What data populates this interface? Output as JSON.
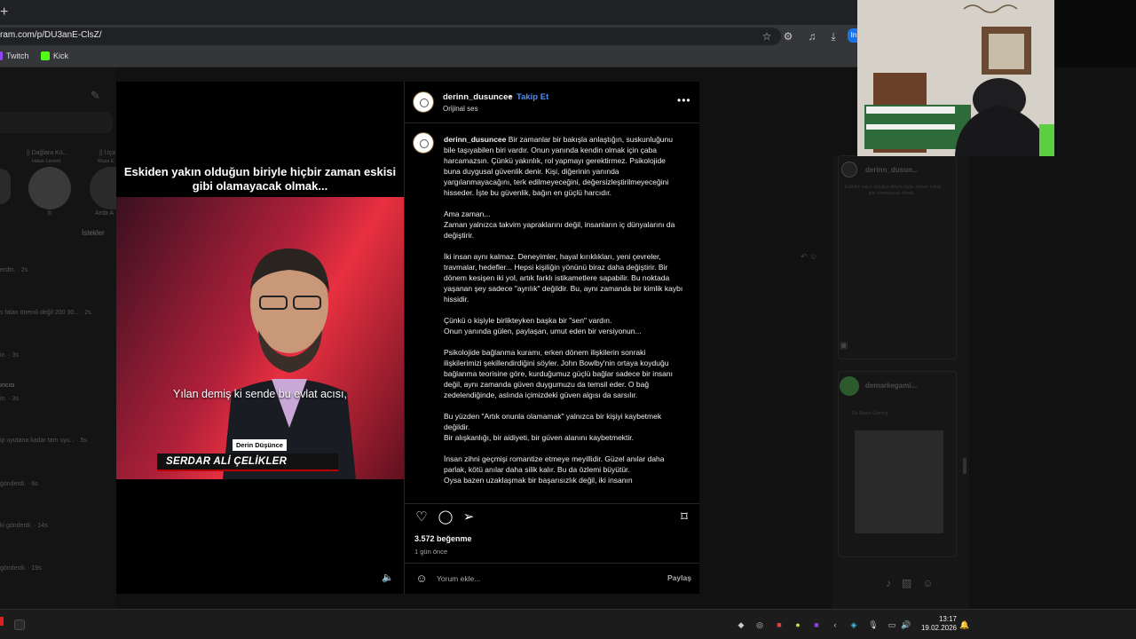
{
  "browser": {
    "new_tab": "+",
    "url": "ram.com/p/DU3anE-ClsZ/",
    "profile_initial": "In",
    "bookmarks": [
      {
        "label": "Twitch",
        "color": "#9146ff"
      },
      {
        "label": "Kick",
        "color": "#53fc18"
      }
    ]
  },
  "left_panel": {
    "stories": [
      "|| Dağlara Kü...",
      "|| Uça"
    ],
    "story_subs": [
      "Haluk Levent",
      "Musa E"
    ],
    "story_names": [
      "b",
      "Arda A"
    ],
    "requests": "İstekler",
    "rows": [
      "erdin. · 2s",
      "s falan önemli değil 200 30... · 2s",
      "in. · 3s",
      "ıncısı",
      "in. · 3s",
      "ip uyutana kadar tam uyu... · 5s",
      "gönderdi. · 6s",
      "ki gönderdi. · 14s",
      "gönderdi. · 19s"
    ]
  },
  "media": {
    "overlay_title": "Eskiden yakın olduğun biriyle hiçbir zaman eskisi gibi olamayacak olmak...",
    "subtitle": "Yılan demiş ki sende bu evlat acısı,",
    "badge": "Derin Düşünce",
    "name_bar": "SERDAR ALİ ÇELİKLER"
  },
  "post": {
    "username": "derinn_dusuncee",
    "separator": "•",
    "follow_label": "Takip Et",
    "audio": "Orijinal ses",
    "caption_user": "derinn_dusuncee",
    "caption_paragraphs": [
      "Bir zamanlar bir bakışla anlaştığın, suskunluğunu bile taşıyabilen biri vardır. Onun yanında kendin olmak için çaba harcamazsın. Çünkü yakınlık, rol yapmayı gerektirmez. Psikolojide buna duygusal güvenlik denir. Kişi, diğerinin yanında yargılanmayacağını, terk edilmeyeceğini, değersizleştirilmeyeceğini hisseder. İşte bu güvenlik, bağın en güçlü harcıdır.",
      "Ama zaman...\nZaman yalnızca takvim yapraklarını değil, insanların iç dünyalarını da değiştirir.",
      "İki insan aynı kalmaz. Deneyimler, hayal kırıklıkları, yeni çevreler, travmalar, hedefler... Hepsi kişiliğin yönünü biraz daha değiştirir. Bir dönem kesişen iki yol, artık farklı istikametlere sapabilir. Bu noktada yaşanan şey sadece \"ayrılık\" değildir. Bu, aynı zamanda bir kimlik kaybı hissidir.",
      "Çünkü o kişiyle birlikteyken başka bir \"sen\" vardın.\nOnun yanında gülen, paylaşan, umut eden bir versiyonun...",
      "Psikolojide bağlanma kuramı, erken dönem ilişkilerin sonraki ilişkilerimizi şekillendirdiğini söyler. John Bowlby'nin ortaya koyduğu bağlanma teorisine göre, kurduğumuz güçlü bağlar sadece bir insanı değil, aynı zamanda güven duygumuzu da temsil eder. O bağ zedelendiğinde, aslında içimizdeki güven algısı da sarsılır.",
      "Bu yüzden \"Artık onunla olamamak\" yalnızca bir kişiyi kaybetmek değildir.\nBir alışkanlığı, bir aidiyeti, bir güven alanını kaybetmektir.",
      "İnsan zihni geçmişi romantize etmeye meyillidir. Güzel anılar daha parlak, kötü anılar daha silik kalır. Bu da özlemi büyütür.\nOysa bazen uzaklaşmak bir başarısızlık değil, iki insanın"
    ],
    "likes": "3.572 beğenme",
    "time_ago": "1 gün önce",
    "comment_placeholder": "Yorum ekle...",
    "share_label": "Paylaş"
  },
  "right_panel": {
    "card1_user": "derinn_dusun...",
    "card1_text": "Eskiden yakın olduğun biriyle hiçbir zaman eskisi gibi olamayacak olmak...",
    "card2_user": "demarkegami...",
    "card2_sub": "De Marke Gaming"
  },
  "taskbar": {
    "time": "13:17",
    "date": "19.02.2026"
  }
}
